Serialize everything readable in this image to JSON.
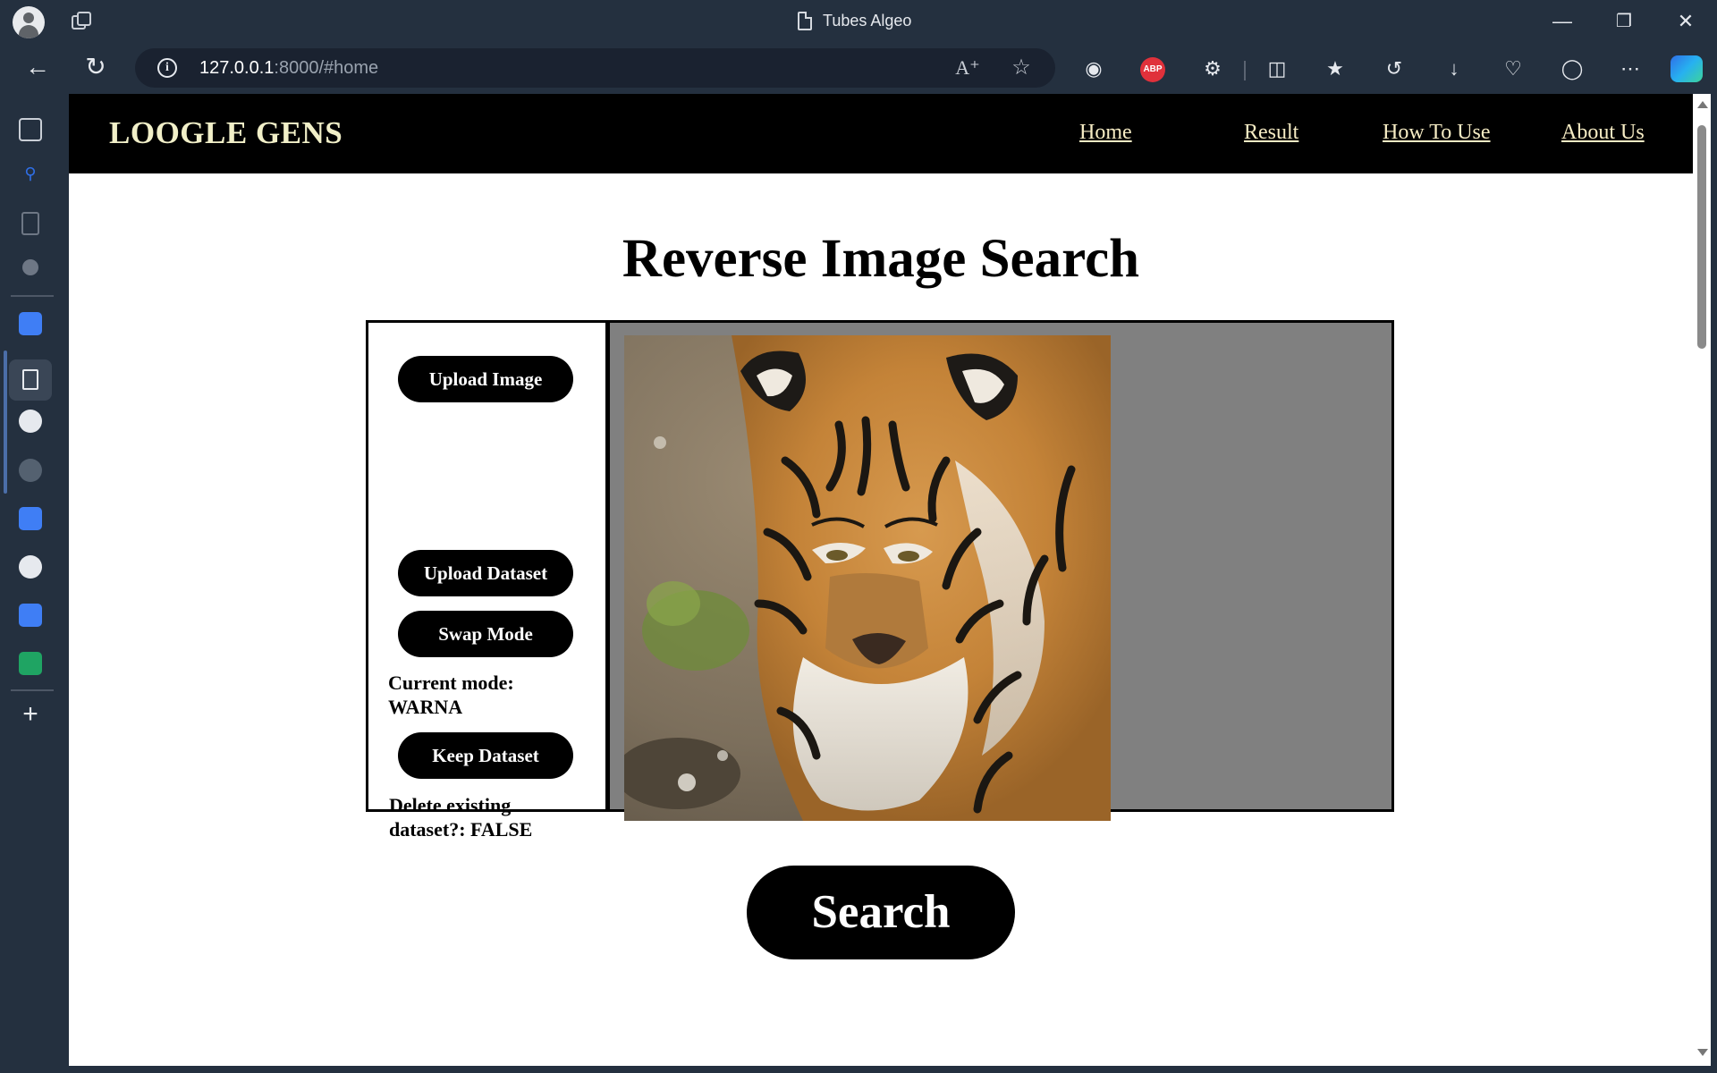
{
  "browser": {
    "tab_title": "Tubes Algeo",
    "url_host": "127.0.0.1",
    "url_rest": ":8000/#home",
    "window_controls": [
      "minimize-icon",
      "restore-icon",
      "close-icon"
    ],
    "info_glyph": "i"
  },
  "site": {
    "logo": "LOOGLE GENS",
    "nav": [
      "Home",
      "Result",
      "How To Use",
      "About Us"
    ],
    "heading": "Reverse Image Search",
    "upload_image": "Upload Image",
    "upload_dataset": "Upload Dataset",
    "swap_mode": "Swap Mode",
    "current_mode": "Current mode:\nWARNA",
    "keep_dataset": "Keep Dataset",
    "delete_existing": "Delete existing\ndataset?: FALSE",
    "search": "Search"
  },
  "colors": {
    "chrome_bg": "#24303f",
    "nav_bg": "#000000",
    "nav_link": "#f6ecc4",
    "panel_gray": "#808080",
    "abp_red": "#e0313b"
  }
}
